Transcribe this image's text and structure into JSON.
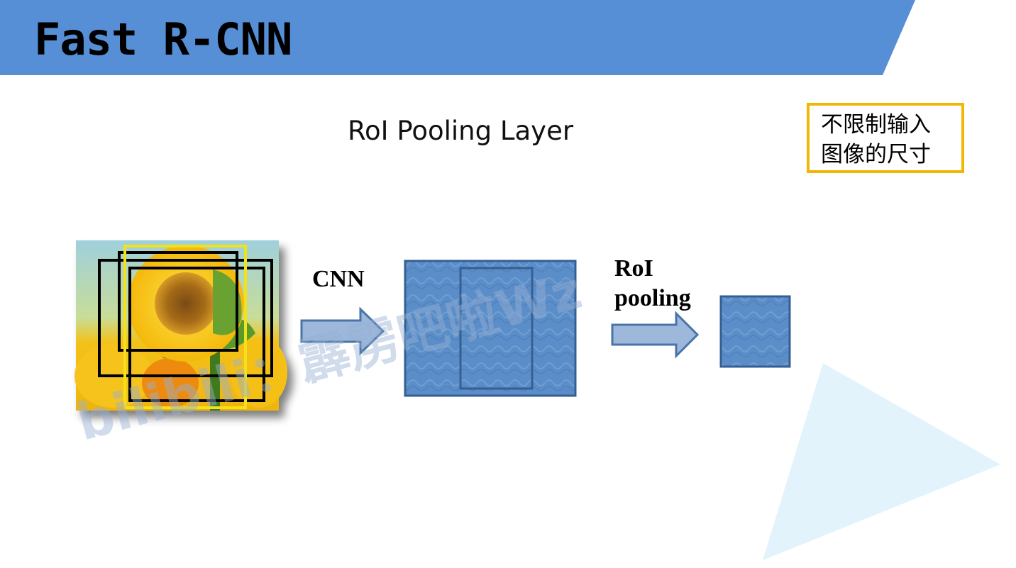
{
  "slide": {
    "title": "Fast R-CNN",
    "subtitle": "RoI Pooling Layer"
  },
  "note": {
    "line1": "不限制输入",
    "line2": "图像的尺寸"
  },
  "diagram": {
    "cnn_label": "CNN",
    "roi_label_line1": "RoI",
    "roi_label_line2": "pooling"
  },
  "watermark": {
    "text": "bilibili：霹雳吧啦Wz"
  },
  "colors": {
    "header_blue": "#568fd6",
    "box_fill": "#5b8ec8",
    "box_border": "#355f93",
    "arrow_fill": "#9db8da",
    "arrow_border": "#4a74a8",
    "note_border": "#f2b705",
    "triangle": "#e3f3fb"
  }
}
